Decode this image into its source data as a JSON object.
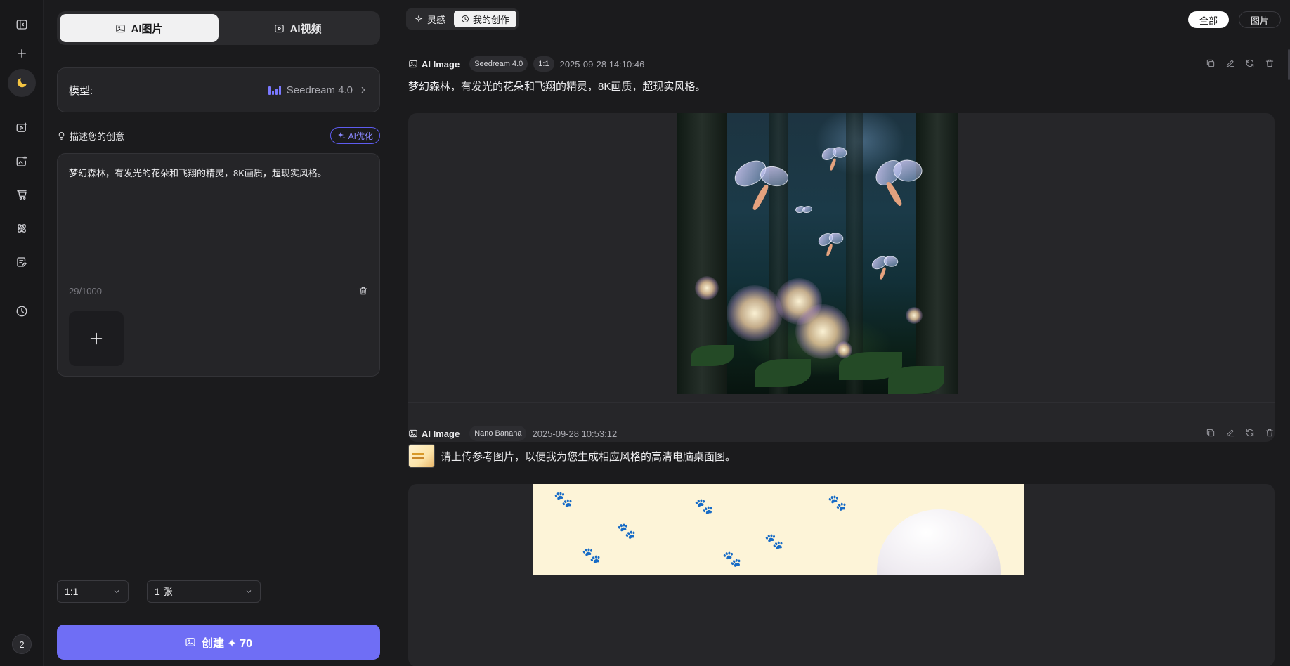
{
  "rail": {
    "items": [
      {
        "name": "sidebar-toggle-icon"
      },
      {
        "name": "new-icon"
      },
      {
        "name": "moon-icon",
        "active": true
      },
      {
        "name": "video-icon"
      },
      {
        "name": "image-edit-icon"
      },
      {
        "name": "cart-icon"
      },
      {
        "name": "atom-icon"
      },
      {
        "name": "note-edit-icon"
      },
      {
        "name": "history-icon"
      }
    ],
    "badge": "2"
  },
  "panel": {
    "mode_tabs": [
      {
        "label": "AI图片",
        "active": true
      },
      {
        "label": "AI视频",
        "active": false
      }
    ],
    "model_label": "模型:",
    "model_value": "Seedream 4.0",
    "describe_label": "描述您的创意",
    "ai_optimize": "AI优化",
    "prompt_text": "梦幻森林，有发光的花朵和飞翔的精灵，8K画质，超现实风格。",
    "char_count": "29/1000",
    "ratio": "1:1",
    "count": "1 张",
    "create_label": "创建 ✦ 70"
  },
  "main": {
    "tabs": [
      {
        "label": "灵感",
        "active": false
      },
      {
        "label": "我的创作",
        "active": true
      }
    ],
    "filters": [
      {
        "label": "全部",
        "active": true
      },
      {
        "label": "图片",
        "active": false
      }
    ],
    "entries": [
      {
        "kind": "AI Image",
        "model": "Seedream 4.0",
        "ratio": "1:1",
        "time": "2025-09-28 14:10:46",
        "prompt": "梦幻森林，有发光的花朵和飞翔的精灵，8K画质，超现实风格。"
      },
      {
        "kind": "AI Image",
        "model": "Nano Banana",
        "time": "2025-09-28 10:53:12",
        "prompt": "请上传参考图片，以便我为您生成相应风格的高清电脑桌面图。"
      }
    ]
  },
  "colors": {
    "accent": "#6f6ef5",
    "background": "#1b1b1d",
    "panel": "#252528"
  }
}
